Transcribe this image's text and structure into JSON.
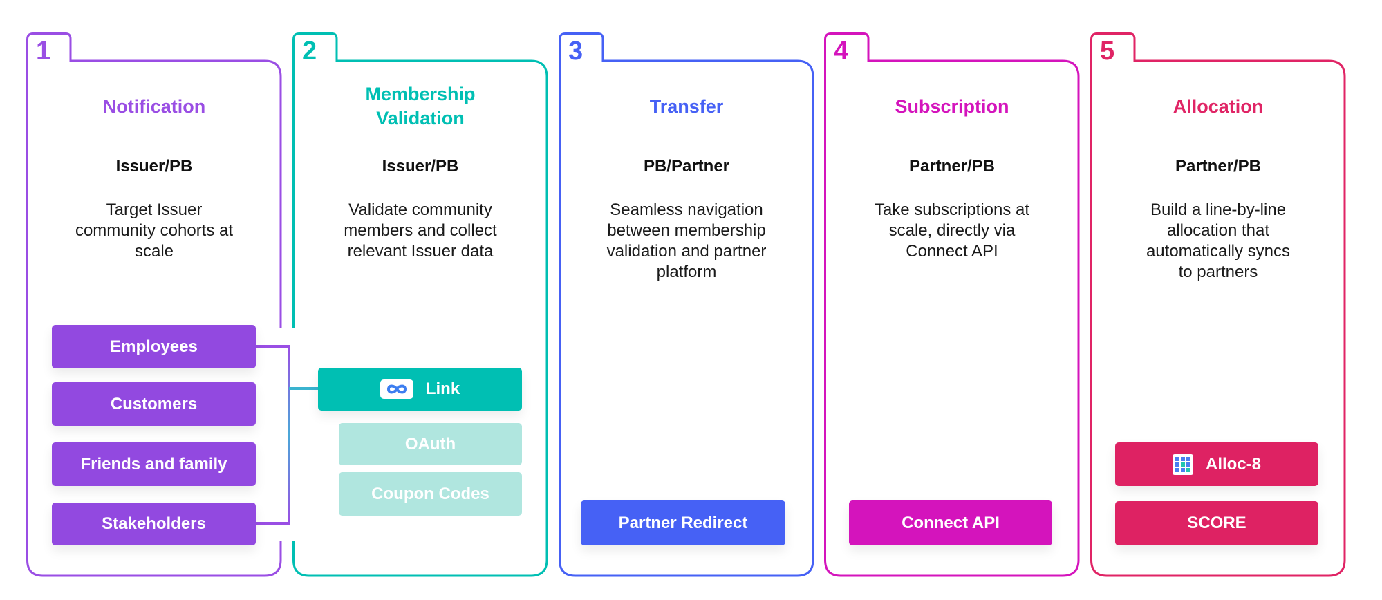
{
  "colors": {
    "notification": "#9a4ee4",
    "membership": "#00bfb3",
    "membership_light": "#b0e6df",
    "transfer": "#4661f5",
    "subscription": "#d414bc",
    "allocation": "#e02465"
  },
  "steps": [
    {
      "number": "1",
      "title": "Notification",
      "role": "Issuer/PB",
      "description": "Target Issuer community cohorts at scale",
      "options": [
        "Employees",
        "Customers",
        "Friends and family",
        "Stakeholders"
      ]
    },
    {
      "number": "2",
      "title": "Membership Validation",
      "role": "Issuer/PB",
      "description": "Validate community members and collect relevant Issuer data",
      "options": [
        {
          "label": "Link",
          "icon": "infinity-icon"
        },
        {
          "label": "OAuth"
        },
        {
          "label": "Coupon Codes"
        }
      ]
    },
    {
      "number": "3",
      "title": "Transfer",
      "role": "PB/Partner",
      "description": "Seamless navigation between membership validation and partner platform",
      "options": [
        "Partner Redirect"
      ]
    },
    {
      "number": "4",
      "title": "Subscription",
      "role": "Partner/PB",
      "description": "Take subscriptions at scale, directly via Connect API",
      "options": [
        "Connect API"
      ]
    },
    {
      "number": "5",
      "title": "Allocation",
      "role": "Partner/PB",
      "description": "Build a line-by-line allocation that automatically syncs to partners",
      "options": [
        {
          "label": "Alloc-8",
          "icon": "grid-icon"
        },
        {
          "label": "SCORE"
        }
      ]
    }
  ]
}
